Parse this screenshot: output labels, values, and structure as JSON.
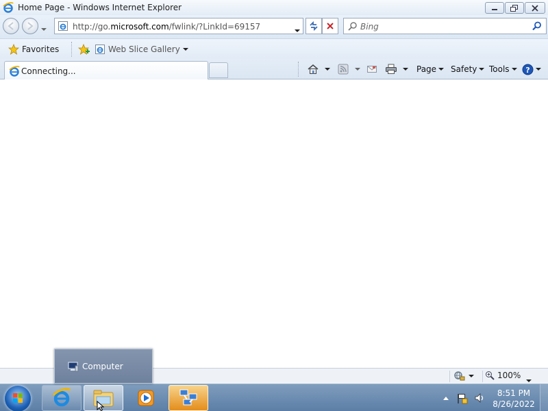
{
  "window": {
    "title": "Home Page - Windows Internet Explorer",
    "minimize_label": "minimize",
    "restore_label": "restore",
    "close_label": "close"
  },
  "nav": {
    "address_url_prefix": "http://go.",
    "address_url_domain": "microsoft.com",
    "address_url_suffix": "/fwlink/?LinkId=69157",
    "search_placeholder": "Bing"
  },
  "favorites_bar": {
    "favorites_label": "Favorites",
    "web_slice_label": "Web Slice Gallery"
  },
  "tabs": {
    "active_tab_label": "Connecting..."
  },
  "command_bar": {
    "page_label": "Page",
    "safety_label": "Safety",
    "tools_label": "Tools"
  },
  "status_bar": {
    "zoom": "100%"
  },
  "taskbar": {
    "time": "8:51 PM",
    "date": "8/26/2022",
    "popup_label": "Computer"
  },
  "colors": {
    "accent": "#1b5fb4",
    "stop_red": "#c0282d",
    "help_blue": "#1e57b8",
    "hot_button": "#e38d1b"
  }
}
